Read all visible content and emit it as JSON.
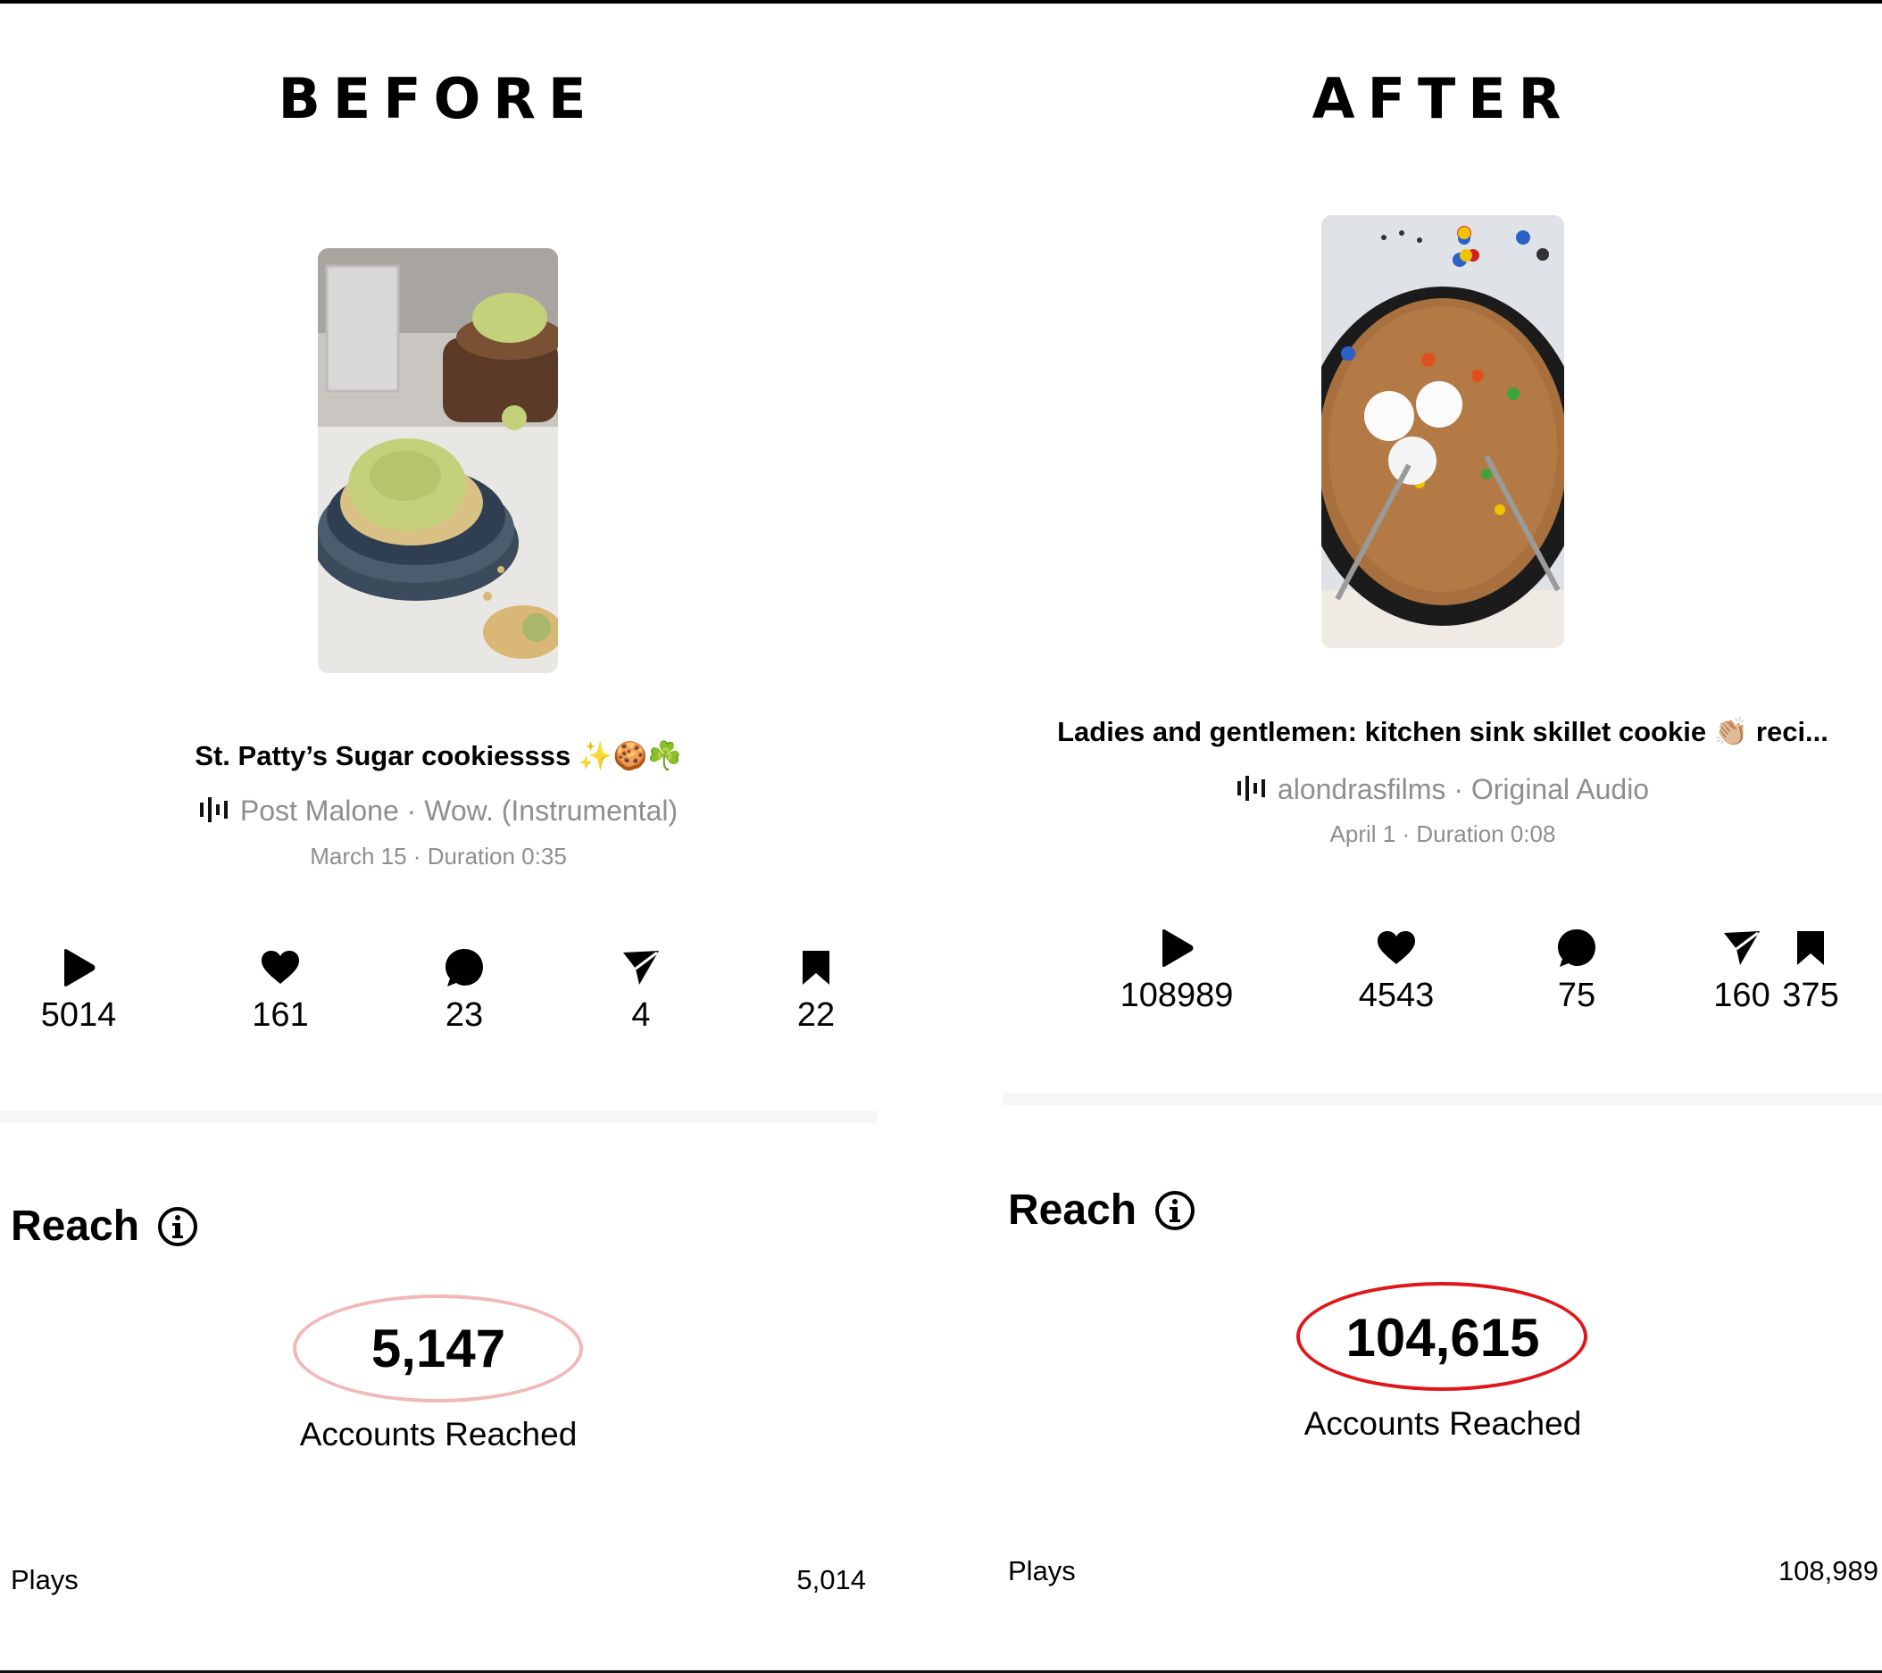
{
  "before": {
    "heading": "BEFORE",
    "title": "St. Patty’s Sugar cookiessss ✨🍪☘️",
    "audio": "Post Malone · Wow. (Instrumental)",
    "meta": "March 15 · Duration 0:35",
    "stats": {
      "plays": "5014",
      "likes": "161",
      "comments": "23",
      "shares": "4",
      "saves": "22"
    },
    "reach_label": "Reach",
    "accounts_reached": "5,147",
    "accounts_reached_label": "Accounts Reached",
    "plays_label": "Plays",
    "plays_value": "5,014",
    "ring_color": "#f2b8b8"
  },
  "after": {
    "heading": "AFTER",
    "title": "Ladies and gentlemen: kitchen sink skillet cookie 👏🏼 reci...",
    "audio": "alondrasfilms · Original Audio",
    "meta": "April 1 · Duration 0:08",
    "stats": {
      "plays": "108989",
      "likes": "4543",
      "comments": "75",
      "shares": "160",
      "saves": "375"
    },
    "reach_label": "Reach",
    "accounts_reached": "104,615",
    "accounts_reached_label": "Accounts Reached",
    "plays_label": "Plays",
    "plays_value": "108,989",
    "ring_color": "#e0161b"
  }
}
